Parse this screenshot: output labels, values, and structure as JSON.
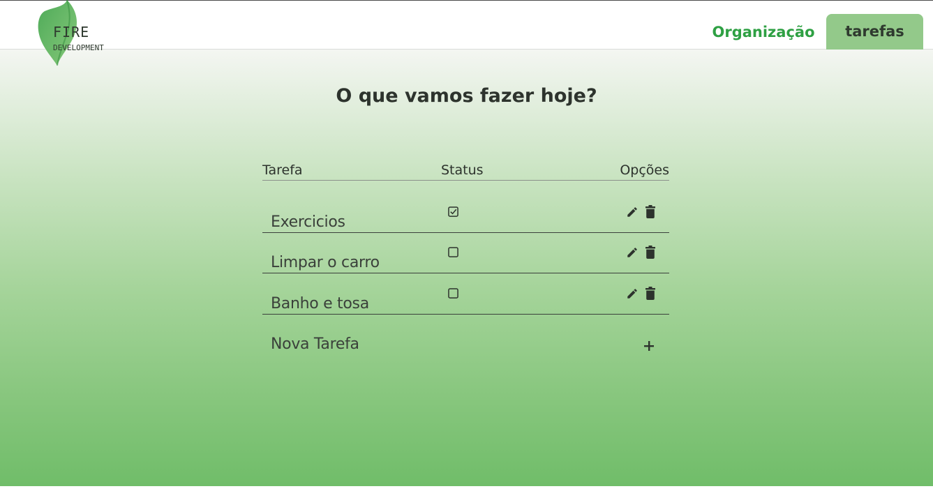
{
  "brand": {
    "title": "FIRE",
    "subtitle": "DEVELOPMENT",
    "logo_icon": "leaf-logo-icon",
    "accent_color": "#2ea043"
  },
  "nav": {
    "items": [
      {
        "label": "Organização",
        "active": false
      },
      {
        "label": "tarefas",
        "active": true
      }
    ]
  },
  "page": {
    "title": "O que vamos fazer hoje?"
  },
  "table": {
    "columns": [
      "Tarefa",
      "Status",
      "Opções"
    ],
    "rows": [
      {
        "name": "Exercicios",
        "done": true
      },
      {
        "name": "Limpar o carro",
        "done": false
      },
      {
        "name": "Banho e tosa",
        "done": false
      }
    ],
    "row_icons": {
      "edit": "pencil-icon",
      "delete": "trash-icon"
    },
    "new_task_label": "Nova Tarefa",
    "add_icon": "plus-icon"
  },
  "colors": {
    "tab_active_bg": "#93c98a",
    "gradient_top": "#f4f6f2",
    "gradient_bottom": "#70bd69"
  }
}
